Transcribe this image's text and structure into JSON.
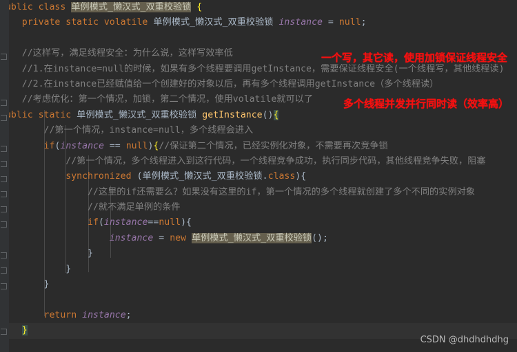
{
  "editor": {
    "class_name": "单例模式_懒汉式_双重校验锁",
    "watermark": "CSDN @dhdhdhdhg",
    "colors": {
      "background": "#2b2b2b",
      "gutter": "#313335",
      "keyword": "#cc7832",
      "comment": "#808080",
      "field": "#9876aa",
      "method": "#ffc66d",
      "default_text": "#a9b7c6",
      "identifier_highlight_bg": "#655f4d",
      "brace_highlight_bg": "#3b514d",
      "brace_highlight_fg": "#ffef28",
      "annotation_red": "#f51010",
      "current_line_bg": "#323232"
    }
  },
  "annotations": [
    {
      "id": "annot-1",
      "text": "一个写，其它读，使用加锁保证线程安全"
    },
    {
      "id": "annot-2",
      "text": "多个线程并发并行同时读（效率高）"
    }
  ],
  "code": {
    "l1_kw_public": "public",
    "l1_kw_class": "class",
    "l1_name": "单例模式_懒汉式_双重校验锁",
    "l1_brace": "{",
    "l2_kw": "private static volatile",
    "l2_type": "单例模式_懒汉式_双重校验锁",
    "l2_field": "instance",
    "l2_eq": "=",
    "l2_null": "null",
    "l2_semi": ";",
    "l4_comment": "//这样写，满足线程安全：为什么说，这样写效率低",
    "l5_comment": "//1.在instance=null的时候，如果有多个线程要调用getInstance，需要保证线程安全(一个线程写，其他线程读)",
    "l6_comment": "//2.在instance已经赋值给一个创建好的对象以后，再有多个线程调用getInstance（多个线程读）",
    "l7_comment": "//考虑优化：第一个情况，加锁，第二个情况，使用volatile就可以了",
    "l8_kw": "public static",
    "l8_type": "单例模式_懒汉式_双重校验锁",
    "l8_method": "getInstance",
    "l8_parens": "()",
    "l8_brace": "{",
    "l9_comment": "//第一个情况，instance=null，多个线程会进入",
    "l10_if": "if",
    "l10_lp": "(",
    "l10_field": "instance",
    "l10_op": "==",
    "l10_null": "null",
    "l10_rp": ")",
    "l10_brace": "{",
    "l10_comment": "//保证第二个情况，已经实例化对象，不需要再次竞争锁",
    "l11_comment": "//第一个情况，多个线程进入到这行代码，一个线程竞争成功，执行同步代码，其他线程竞争失败，阻塞",
    "l12_kw": "synchronized",
    "l12_lp": "(",
    "l12_type": "单例模式_懒汉式_双重校验锁",
    "l12_dot": ".",
    "l12_class_kw": "class",
    "l12_rp": ")",
    "l12_brace": "{",
    "l13_comment": "//这里的if还需要么？如果没有这里的if，第一个情况的多个线程就创建了多个不同的实例对象",
    "l14_comment": "//就不满足单例的条件",
    "l15_if": "if",
    "l15_lp": "(",
    "l15_field": "instance",
    "l15_op": "==",
    "l15_null": "null",
    "l15_rp": ")",
    "l15_brace": "{",
    "l16_field": "instance",
    "l16_eq": "=",
    "l16_new": "new",
    "l16_type": "单例模式_懒汉式_双重校验锁",
    "l16_parens": "();",
    "l17_close": "}",
    "l18_close": "}",
    "l19_close": "}",
    "l21_return": "return",
    "l21_field": "instance",
    "l21_semi": ";",
    "l22_close": "}",
    "l23_close": "}"
  }
}
